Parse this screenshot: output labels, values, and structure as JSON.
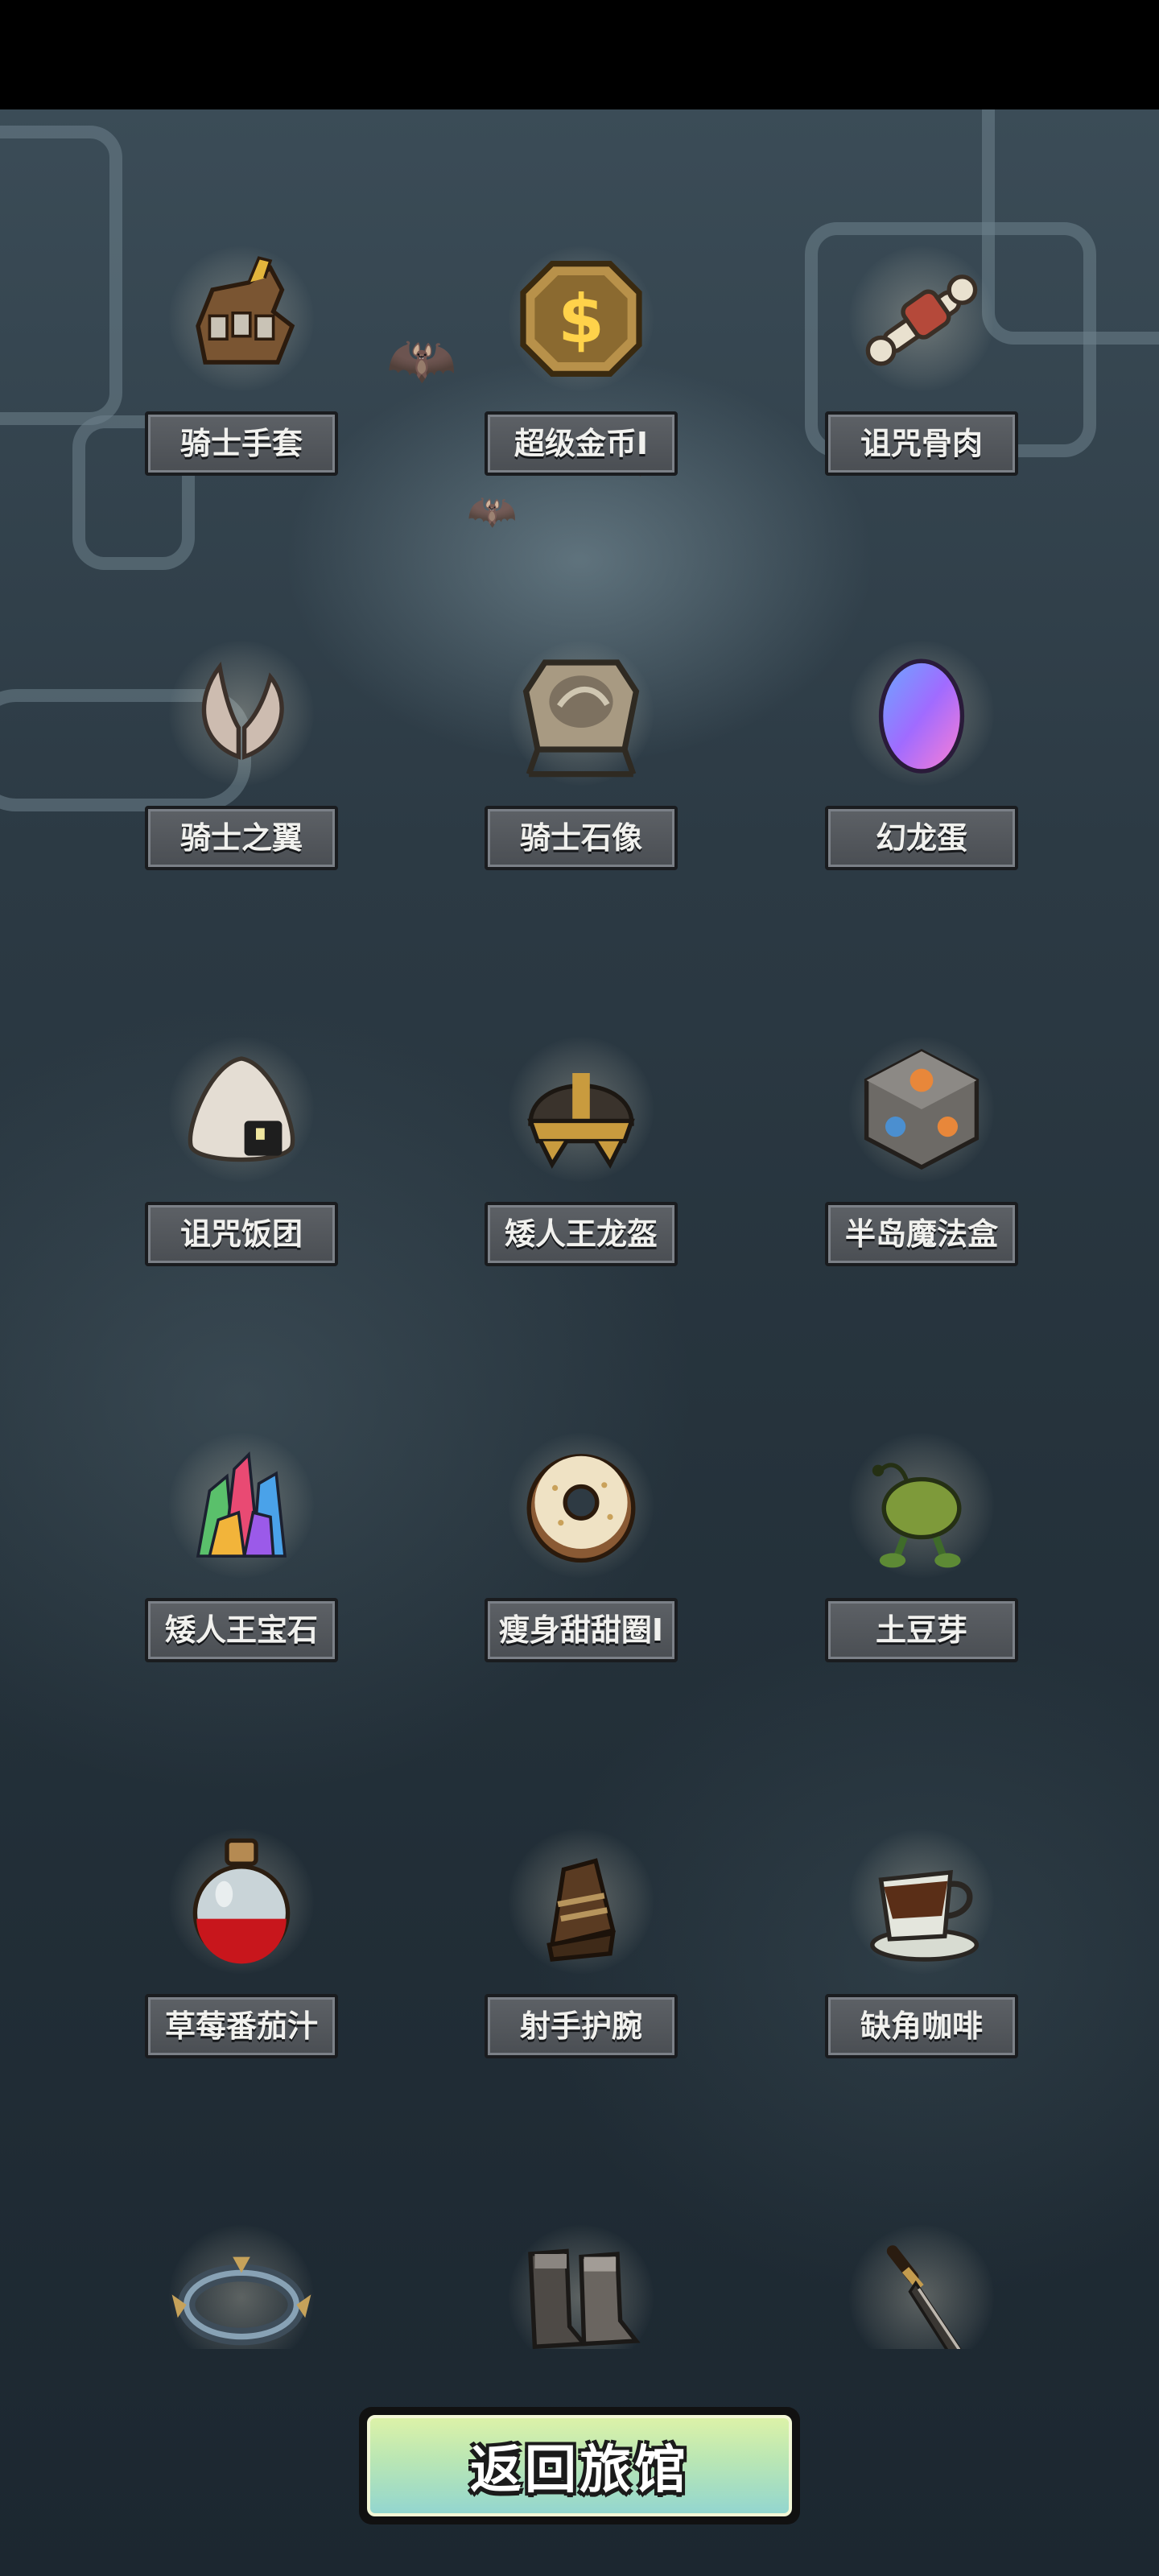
{
  "items": [
    {
      "label": "骑士手套",
      "icon": "knight-gauntlet-icon"
    },
    {
      "label": "超级金币I",
      "icon": "gold-coin-icon"
    },
    {
      "label": "诅咒骨肉",
      "icon": "cursed-bone-meat-icon"
    },
    {
      "label": "骑士之翼",
      "icon": "knight-wings-icon"
    },
    {
      "label": "骑士石像",
      "icon": "knight-stone-statue-icon"
    },
    {
      "label": "幻龙蛋",
      "icon": "dragon-egg-icon"
    },
    {
      "label": "诅咒饭团",
      "icon": "cursed-rice-ball-icon"
    },
    {
      "label": "矮人王龙盔",
      "icon": "dwarf-king-helmet-icon"
    },
    {
      "label": "半岛魔法盒",
      "icon": "magic-box-icon"
    },
    {
      "label": "矮人王宝石",
      "icon": "dwarf-king-gems-icon"
    },
    {
      "label": "瘦身甜甜圈I",
      "icon": "donut-icon"
    },
    {
      "label": "土豆芽",
      "icon": "potato-sprout-icon"
    },
    {
      "label": "草莓番茄汁",
      "icon": "juice-potion-icon"
    },
    {
      "label": "射手护腕",
      "icon": "archer-bracer-icon"
    },
    {
      "label": "缺角咖啡",
      "icon": "chipped-coffee-cup-icon"
    },
    {
      "label": "",
      "icon": "spiked-bracelet-icon"
    },
    {
      "label": "",
      "icon": "iron-boots-icon"
    },
    {
      "label": "",
      "icon": "dagger-icon"
    }
  ],
  "return_button": {
    "label": "返回旅馆"
  }
}
